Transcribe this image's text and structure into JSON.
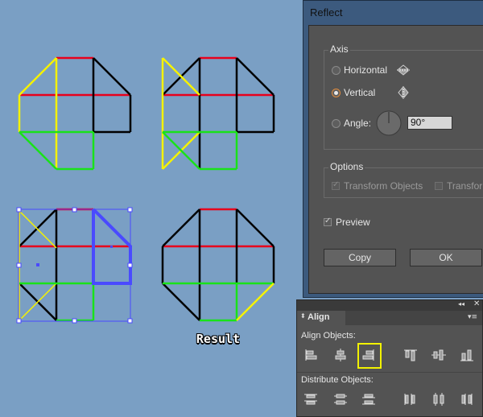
{
  "canvas": {
    "result_label": "Result",
    "colors": {
      "red": "#e8001c",
      "yellow": "#f5f200",
      "green": "#19e219",
      "black": "#000000",
      "selection": "#4a4aff"
    }
  },
  "reflect_dialog": {
    "title": "Reflect",
    "axis_group_label": "Axis",
    "horizontal_label": "Horizontal",
    "vertical_label": "Vertical",
    "angle_label": "Angle:",
    "angle_value": "90°",
    "selected_axis": "Vertical",
    "options_group_label": "Options",
    "transform_objects_label": "Transform Objects",
    "transform_patterns_label": "Transfor",
    "preview_label": "Preview",
    "preview_checked": true,
    "copy_label": "Copy",
    "ok_label": "OK",
    "accent_color": "#e08a3c"
  },
  "align_panel": {
    "title": "Align",
    "align_objects_label": "Align Objects:",
    "distribute_objects_label": "Distribute Objects:",
    "align_buttons": [
      "horizontal-align-left-icon",
      "horizontal-align-center-icon",
      "horizontal-align-right-icon",
      "vertical-align-top-icon",
      "vertical-align-center-icon",
      "vertical-align-bottom-icon"
    ],
    "distribute_buttons": [
      "vertical-distribute-top-icon",
      "vertical-distribute-center-icon",
      "vertical-distribute-bottom-icon",
      "horizontal-distribute-left-icon",
      "horizontal-distribute-center-icon",
      "horizontal-distribute-right-icon"
    ],
    "highlight_color": "#f2f200"
  }
}
